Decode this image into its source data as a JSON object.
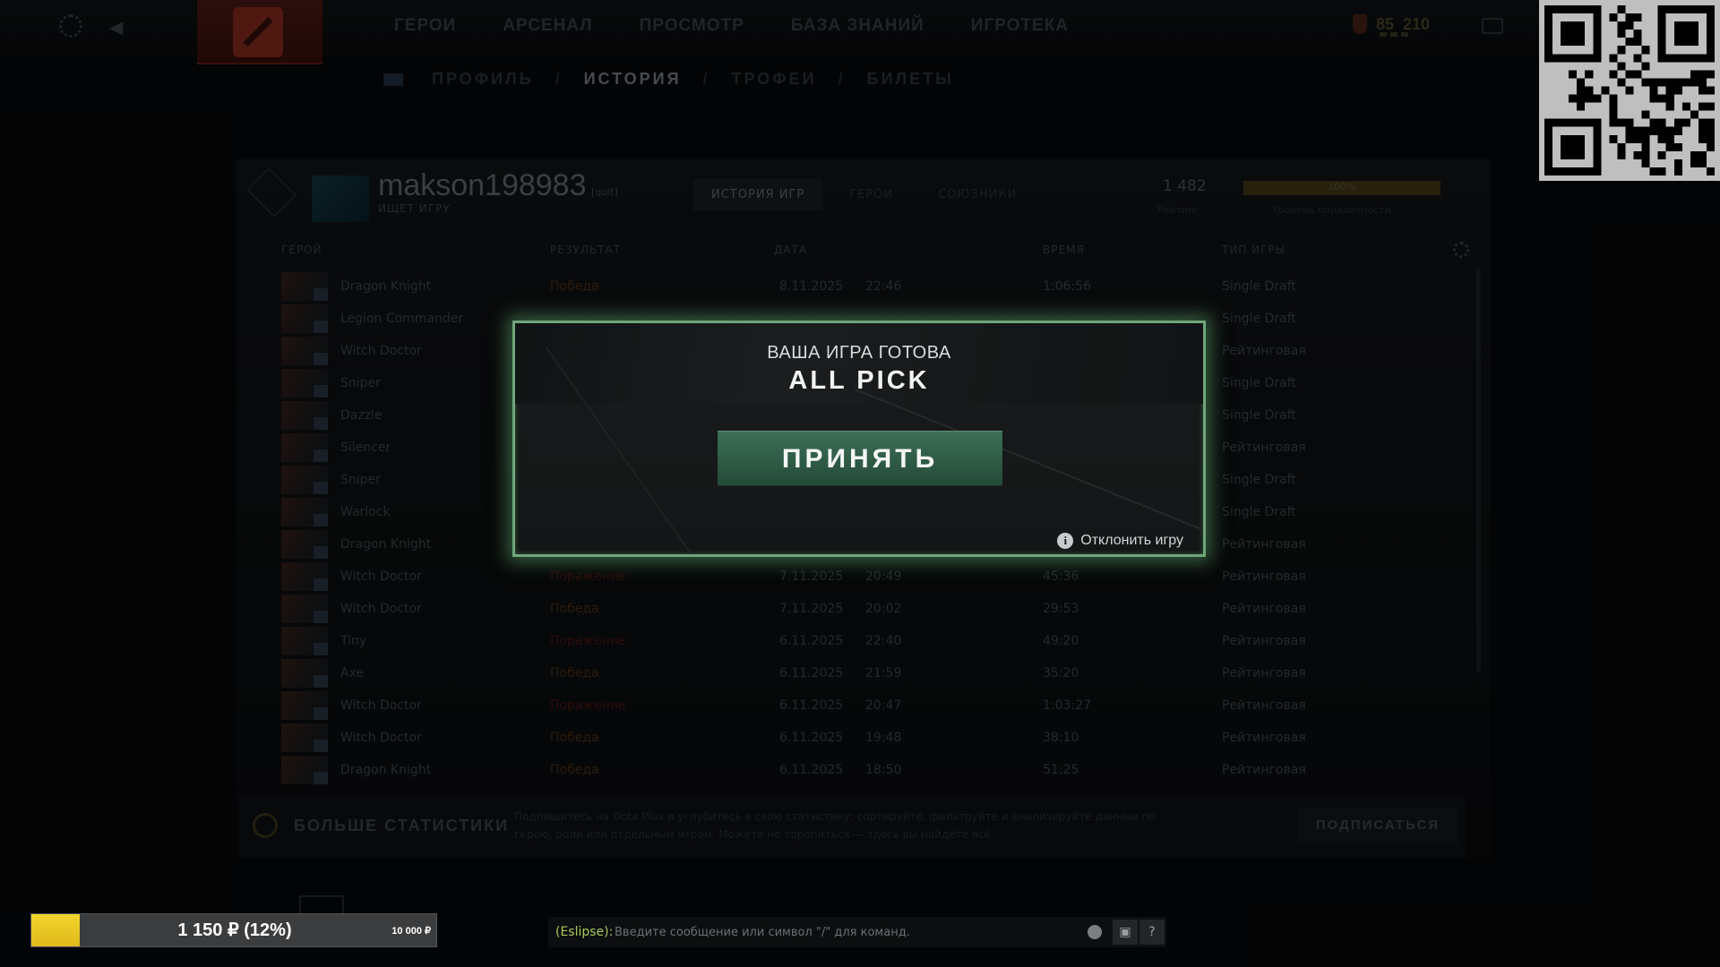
{
  "nav": {
    "items": [
      "ГЕРОИ",
      "АРСЕНАЛ",
      "ПРОСМОТР",
      "БАЗА ЗНАНИЙ",
      "ИГРОТЕКА"
    ],
    "currency_a": "85",
    "currency_b": "210"
  },
  "breadcrumb": [
    "ПРОФИЛЬ",
    "ИСТОРИЯ",
    "ТРОФЕИ",
    "БИЛЕТЫ"
  ],
  "profile": {
    "username": "makson198983",
    "tag": "[quit]",
    "status": "ИЩЕТ ИГРУ",
    "tabs": [
      "ИСТОРИЯ ИГР",
      "ГЕРОИ",
      "СОЮЗНИКИ"
    ],
    "rating": "1 482",
    "rating_label": "Рейтинг",
    "behavior": "100%",
    "behavior_label": "Уровень порядочности"
  },
  "table": {
    "headers": [
      "ГЕРОЙ",
      "РЕЗУЛЬТАТ",
      "ДАТА",
      "ВРЕМЯ",
      "ТИП ИГРЫ"
    ],
    "rows": [
      {
        "hero": "Dragon Knight",
        "result": "Победа",
        "date": "8.11.2025",
        "time": "22:46",
        "duration": "1:06:56",
        "type": "Single Draft"
      },
      {
        "hero": "Legion Commander",
        "result": "",
        "date": "",
        "time": "",
        "duration": "",
        "type": "Single Draft"
      },
      {
        "hero": "Witch Doctor",
        "result": "",
        "date": "",
        "time": "",
        "duration": "",
        "type": "Рейтинговая"
      },
      {
        "hero": "Sniper",
        "result": "",
        "date": "",
        "time": "",
        "duration": "",
        "type": "Single Draft"
      },
      {
        "hero": "Dazzle",
        "result": "",
        "date": "",
        "time": "",
        "duration": "",
        "type": "Single Draft"
      },
      {
        "hero": "Silencer",
        "result": "",
        "date": "",
        "time": "",
        "duration": "",
        "type": "Рейтинговая"
      },
      {
        "hero": "Sniper",
        "result": "",
        "date": "",
        "time": "",
        "duration": "",
        "type": "Single Draft"
      },
      {
        "hero": "Warlock",
        "result": "",
        "date": "",
        "time": "",
        "duration": "",
        "type": "Single Draft"
      },
      {
        "hero": "Dragon Knight",
        "result": "",
        "date": "",
        "time": "",
        "duration": "",
        "type": "Рейтинговая"
      },
      {
        "hero": "Witch Doctor",
        "result": "Поражение",
        "date": "7.11.2025",
        "time": "20:49",
        "duration": "45:36",
        "type": "Рейтинговая"
      },
      {
        "hero": "Witch Doctor",
        "result": "Победа",
        "date": "7.11.2025",
        "time": "20:02",
        "duration": "29:53",
        "type": "Рейтинговая"
      },
      {
        "hero": "Tiny",
        "result": "Поражение",
        "date": "6.11.2025",
        "time": "22:40",
        "duration": "49:20",
        "type": "Рейтинговая"
      },
      {
        "hero": "Axe",
        "result": "Победа",
        "date": "6.11.2025",
        "time": "21:59",
        "duration": "35:20",
        "type": "Рейтинговая"
      },
      {
        "hero": "Witch Doctor",
        "result": "Поражение",
        "date": "6.11.2025",
        "time": "20:47",
        "duration": "1:03:27",
        "type": "Рейтинговая"
      },
      {
        "hero": "Witch Doctor",
        "result": "Победа",
        "date": "6.11.2025",
        "time": "19:48",
        "duration": "38:10",
        "type": "Рейтинговая"
      },
      {
        "hero": "Dragon Knight",
        "result": "Победа",
        "date": "6.11.2025",
        "time": "18:50",
        "duration": "51:25",
        "type": "Рейтинговая"
      }
    ]
  },
  "plus": {
    "title": "БОЛЬШЕ СТАТИСТИКИ",
    "description": "Подпишитесь на Dota Plus и углубитесь в свою статистику: сортируйте, фильтруйте и анализируйте данные по герою, роли или отдельным играм. Можете не торопиться — здесь вы найдёте всё.",
    "button": "ПОДПИСАТЬСЯ"
  },
  "modal": {
    "ready_text": "ВАША ИГРА ГОТОВА",
    "mode": "ALL PICK",
    "accept": "ПРИНЯТЬ",
    "decline": "Отклонить игру",
    "border_color": "#6ea67a",
    "accept_color": "#2f5b46"
  },
  "donation": {
    "label": "1 150 ₽ (12%)",
    "goal": "10 000 ₽",
    "progress_fraction": 0.12,
    "fill_color": "#f2d52c"
  },
  "chat": {
    "channel": "(Eslipse):",
    "placeholder": "Введите сообщение или символ \"/\" для команд.",
    "help": "?"
  }
}
